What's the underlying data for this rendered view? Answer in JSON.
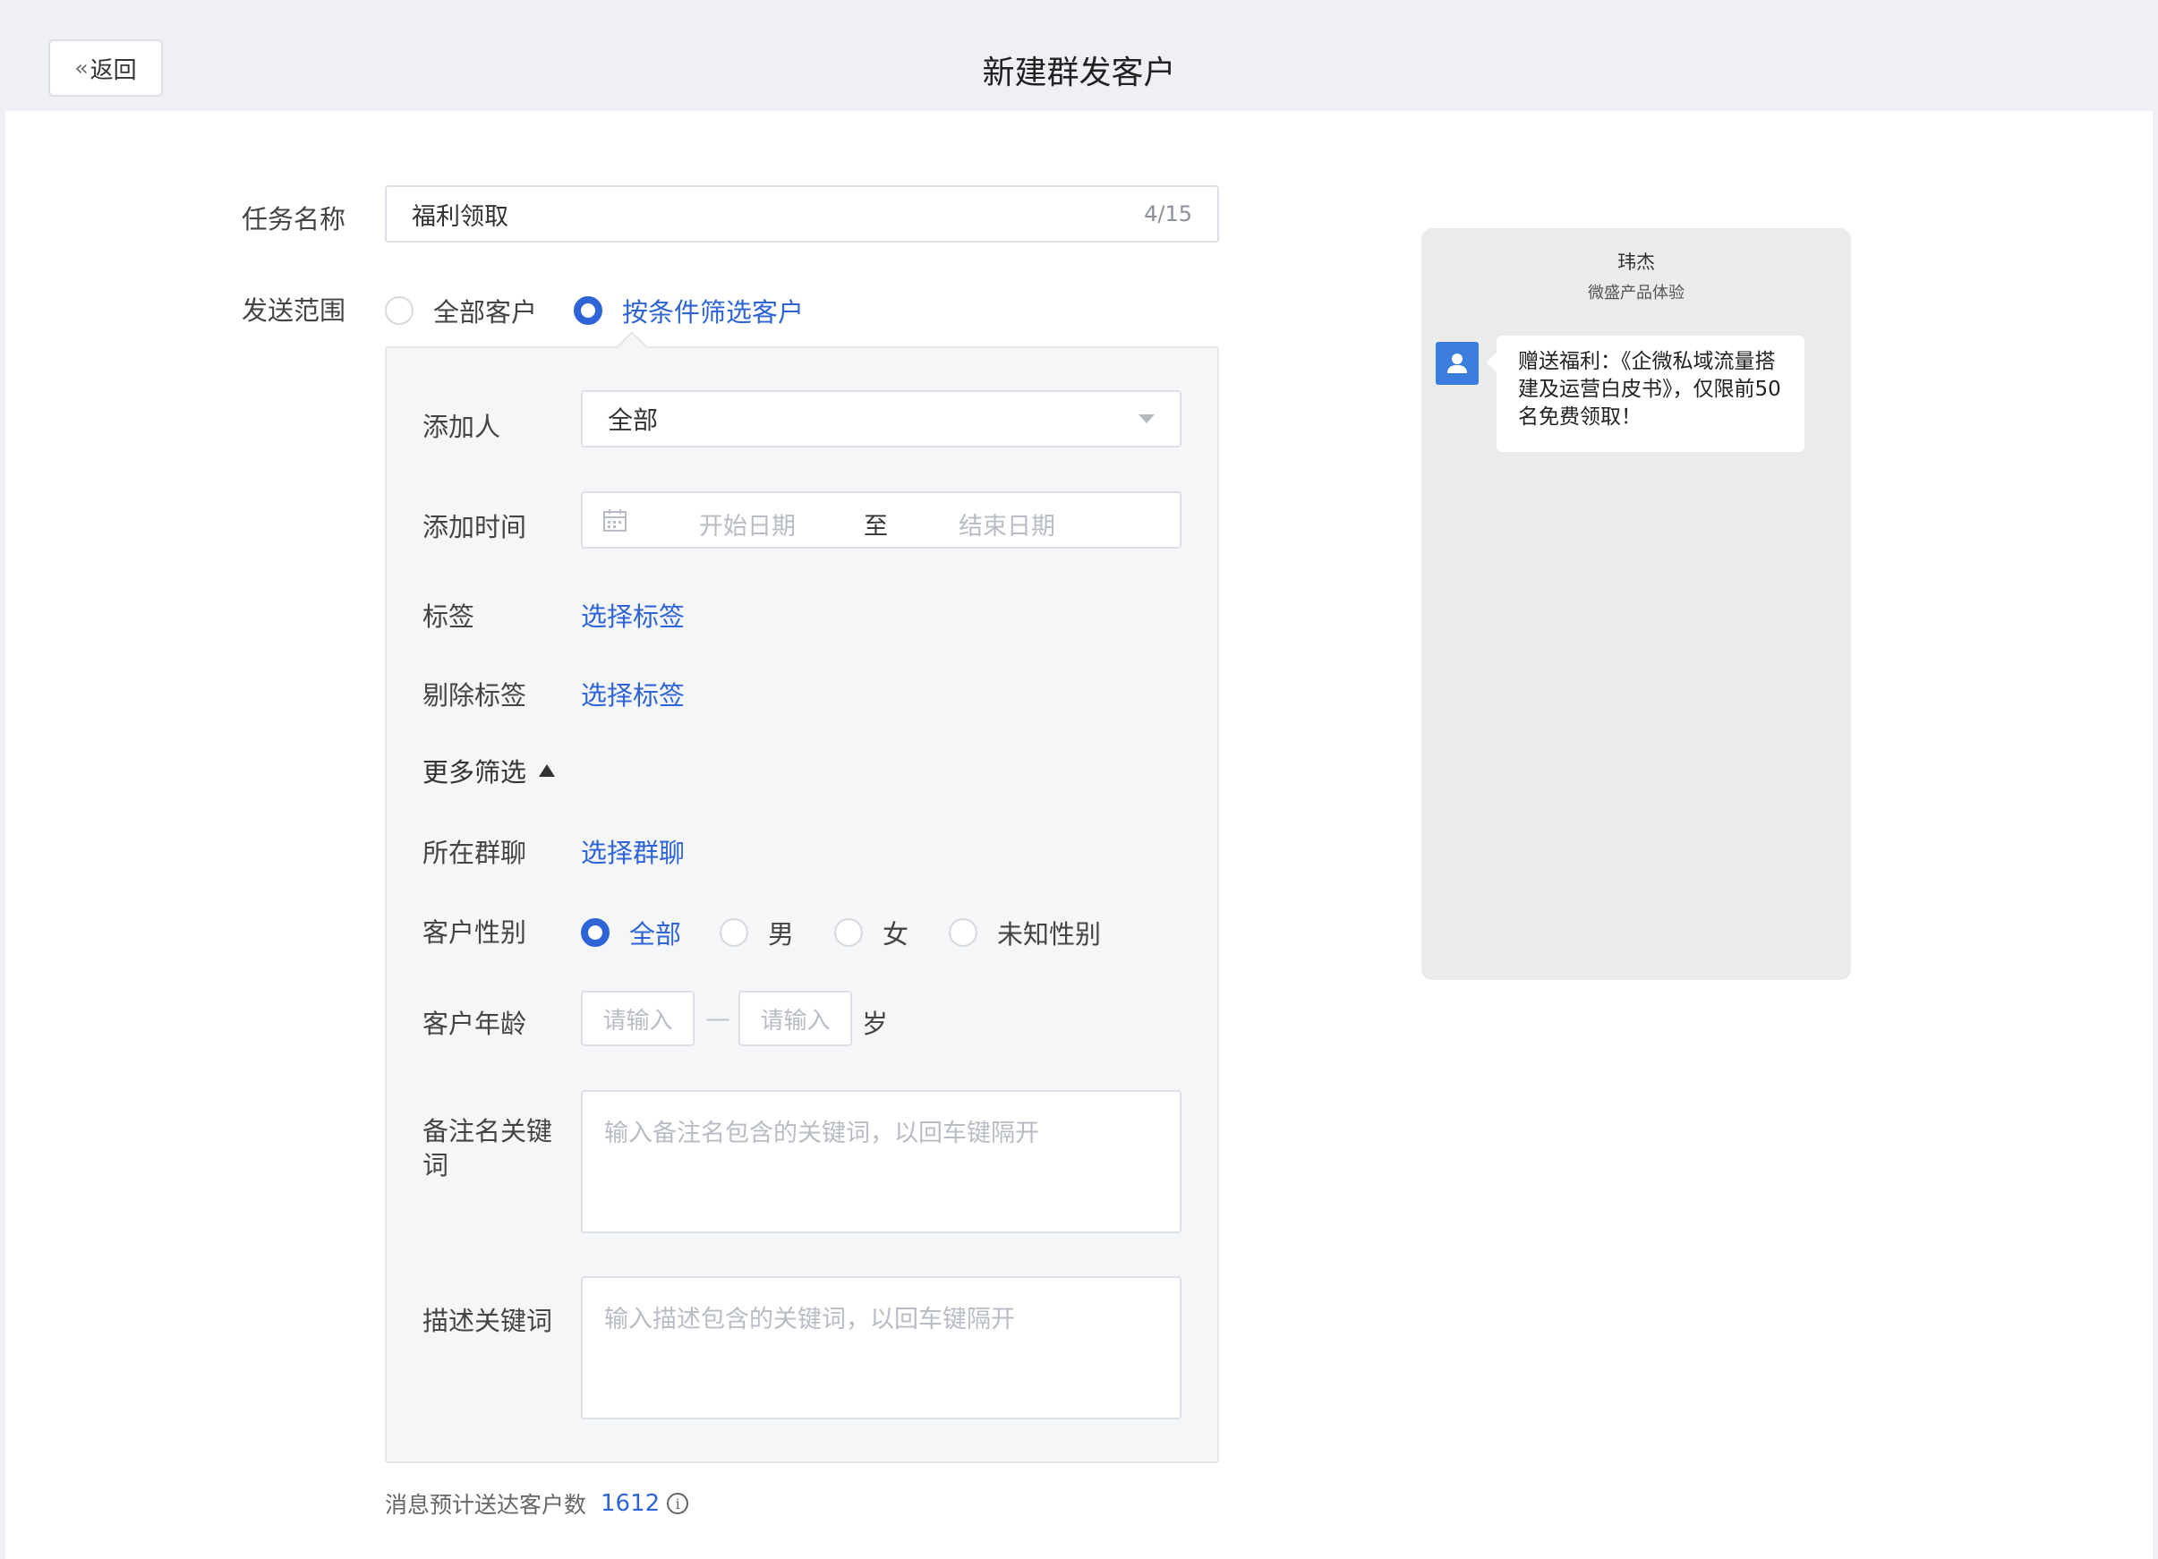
{
  "header": {
    "back_label": "返回",
    "title": "新建群发客户"
  },
  "form": {
    "task_name_label": "任务名称",
    "task_name_value": "福利领取",
    "task_name_count": "4/15",
    "scope_label": "发送范围",
    "scope_options": [
      "全部客户",
      "按条件筛选客户"
    ],
    "scope_selected": "按条件筛选客户"
  },
  "filter": {
    "adder_label": "添加人",
    "adder_value": "全部",
    "add_time_label": "添加时间",
    "start_placeholder": "开始日期",
    "to": "至",
    "end_placeholder": "结束日期",
    "tag_label": "标签",
    "tag_link": "选择标签",
    "exclude_tag_label": "剔除标签",
    "exclude_tag_link": "选择标签",
    "more_label": "更多筛选",
    "group_label": "所在群聊",
    "group_link": "选择群聊",
    "gender_label": "客户性别",
    "gender_options": [
      "全部",
      "男",
      "女",
      "未知性别"
    ],
    "gender_selected": "全部",
    "age_label": "客户年龄",
    "age_min_placeholder": "请输入",
    "age_max_placeholder": "请输入",
    "age_dash": "—",
    "age_unit": "岁",
    "remark_label_line1": "备注名关键",
    "remark_label_line2": "词",
    "remark_placeholder": "输入备注名包含的关键词，以回车键隔开",
    "desc_label": "描述关键词",
    "desc_placeholder": "输入描述包含的关键词，以回车键隔开"
  },
  "footer": {
    "estimate_label": "消息预计送达客户数",
    "estimate_value": "1612",
    "info_icon": "info-icon"
  },
  "preview": {
    "sender_name": "玮杰",
    "sender_org": "微盛产品体验",
    "message": "赠送福利：《企微私域流量搭建及运营白皮书》，仅限前50名免费领取！"
  },
  "colors": {
    "accent": "#2e64d6",
    "page_bg": "#eef0f5",
    "filter_bg": "#f5f6f8",
    "preview_bg": "#ebebeb",
    "avatar": "#3b7ddd"
  }
}
